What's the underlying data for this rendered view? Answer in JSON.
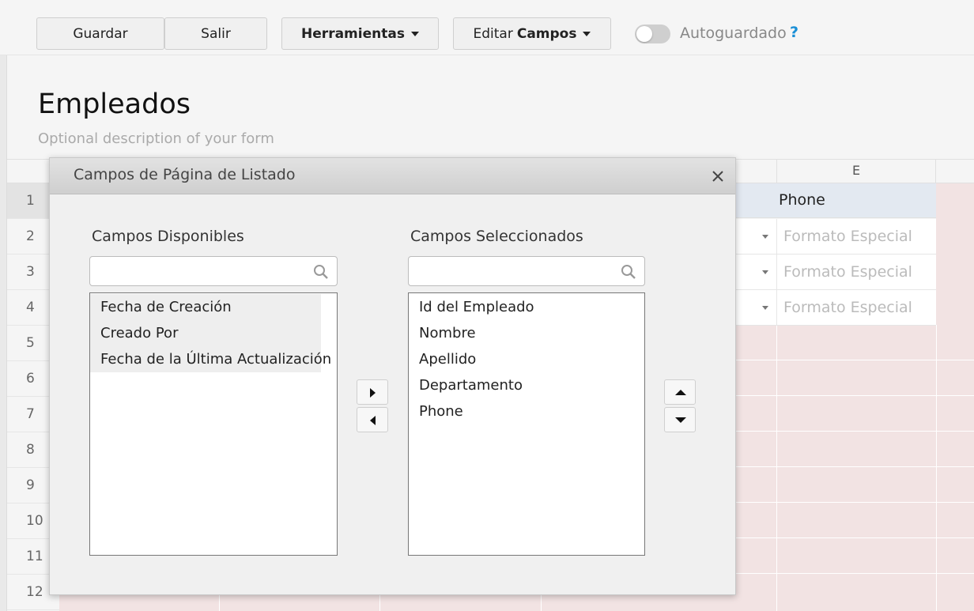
{
  "toolbar": {
    "save_label": "Guardar",
    "exit_label": "Salir",
    "tools_label": "Herramientas",
    "edit_prefix": "Editar",
    "edit_bold": "Campos",
    "autosave_label": "Autoguardado",
    "autosave_on": false,
    "help_label": "?"
  },
  "form": {
    "title": "Empleados",
    "description": "Optional description of your form"
  },
  "grid": {
    "column_e_header": "E",
    "row_numbers": [
      "1",
      "2",
      "3",
      "4",
      "5",
      "6",
      "7",
      "8",
      "9",
      "10",
      "11",
      "12"
    ],
    "phone_cell": "Phone",
    "format_cells": [
      "Formato Especial",
      "Formato Especial",
      "Formato Especial"
    ]
  },
  "dialog": {
    "title": "Campos de Página de Listado",
    "available_label": "Campos Disponibles",
    "selected_label": "Campos Seleccionados",
    "available_search_value": "",
    "selected_search_value": "",
    "available_fields": [
      "Fecha de Creación",
      "Creado Por",
      "Fecha de la Última Actualización"
    ],
    "selected_fields": [
      "Id del Empleado",
      "Nombre",
      "Apellido",
      "Departamento",
      "Phone"
    ]
  },
  "colors": {
    "accent": "#1a8fd6",
    "grid_pink": "#f2e3e3",
    "header_row_blue": "#e3e9f1"
  }
}
